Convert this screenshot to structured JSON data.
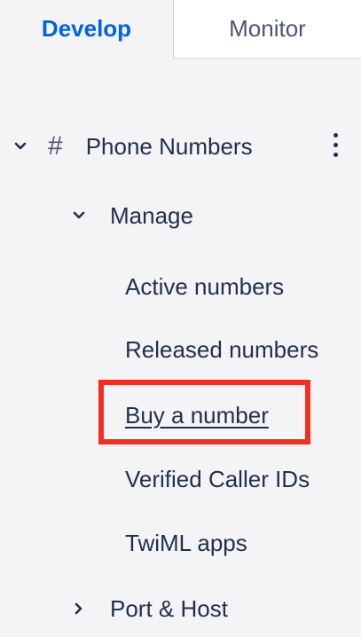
{
  "tabs": {
    "develop": "Develop",
    "monitor": "Monitor"
  },
  "colors": {
    "accent": "#0263e0",
    "text": "#1f304c",
    "highlight": "#f22f21"
  },
  "sidebar": {
    "phone_numbers": {
      "icon": "hash-icon",
      "label": "Phone Numbers",
      "expanded": true
    },
    "manage": {
      "label": "Manage",
      "expanded": true,
      "items": [
        {
          "label": "Active numbers"
        },
        {
          "label": "Released numbers"
        },
        {
          "label": "Buy a number",
          "highlighted": true
        },
        {
          "label": "Verified Caller IDs"
        },
        {
          "label": "TwiML apps"
        }
      ]
    },
    "port_host": {
      "label": "Port & Host",
      "expanded": false
    }
  }
}
